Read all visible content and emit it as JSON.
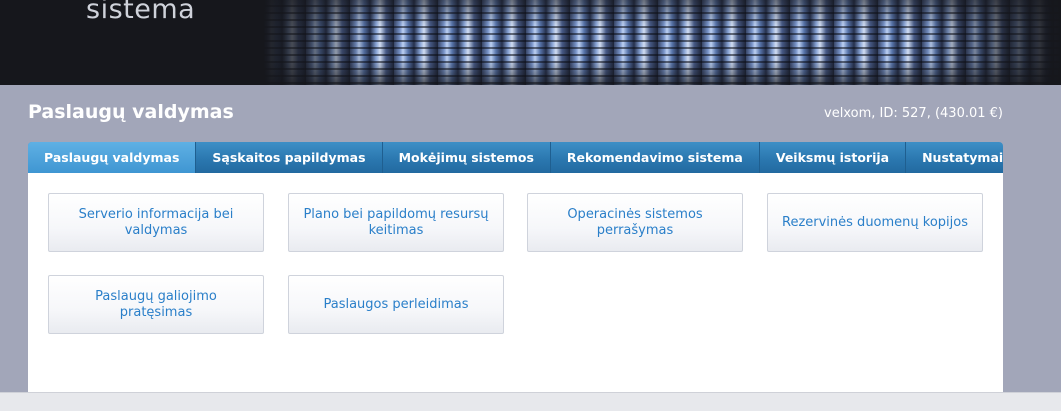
{
  "brand": {
    "text": "sistema"
  },
  "header": {
    "title": "Paslaugų valdymas",
    "account_info": "velxom, ID: 527, (430.01 €)"
  },
  "tabs": [
    {
      "label": "Paslaugų valdymas",
      "active": true
    },
    {
      "label": "Sąskaitos papildymas",
      "active": false
    },
    {
      "label": "Mokėjimų sistemos",
      "active": false
    },
    {
      "label": "Rekomendavimo sistema",
      "active": false
    },
    {
      "label": "Veiksmų istorija",
      "active": false
    },
    {
      "label": "Nustatymai",
      "active": false
    }
  ],
  "cards": [
    {
      "label": "Serverio informacija bei valdymas"
    },
    {
      "label": "Plano bei papildomų resursų keitimas"
    },
    {
      "label": "Operacinės sistemos perrašymas"
    },
    {
      "label": "Rezervinės duomenų kopijos"
    },
    {
      "label": "Paslaugų galiojimo pratęsimas"
    },
    {
      "label": "Paslaugos perleidimas"
    }
  ],
  "colors": {
    "accent": "#2b78b0",
    "link": "#2a7fc9",
    "background": "#a2a6b9"
  }
}
